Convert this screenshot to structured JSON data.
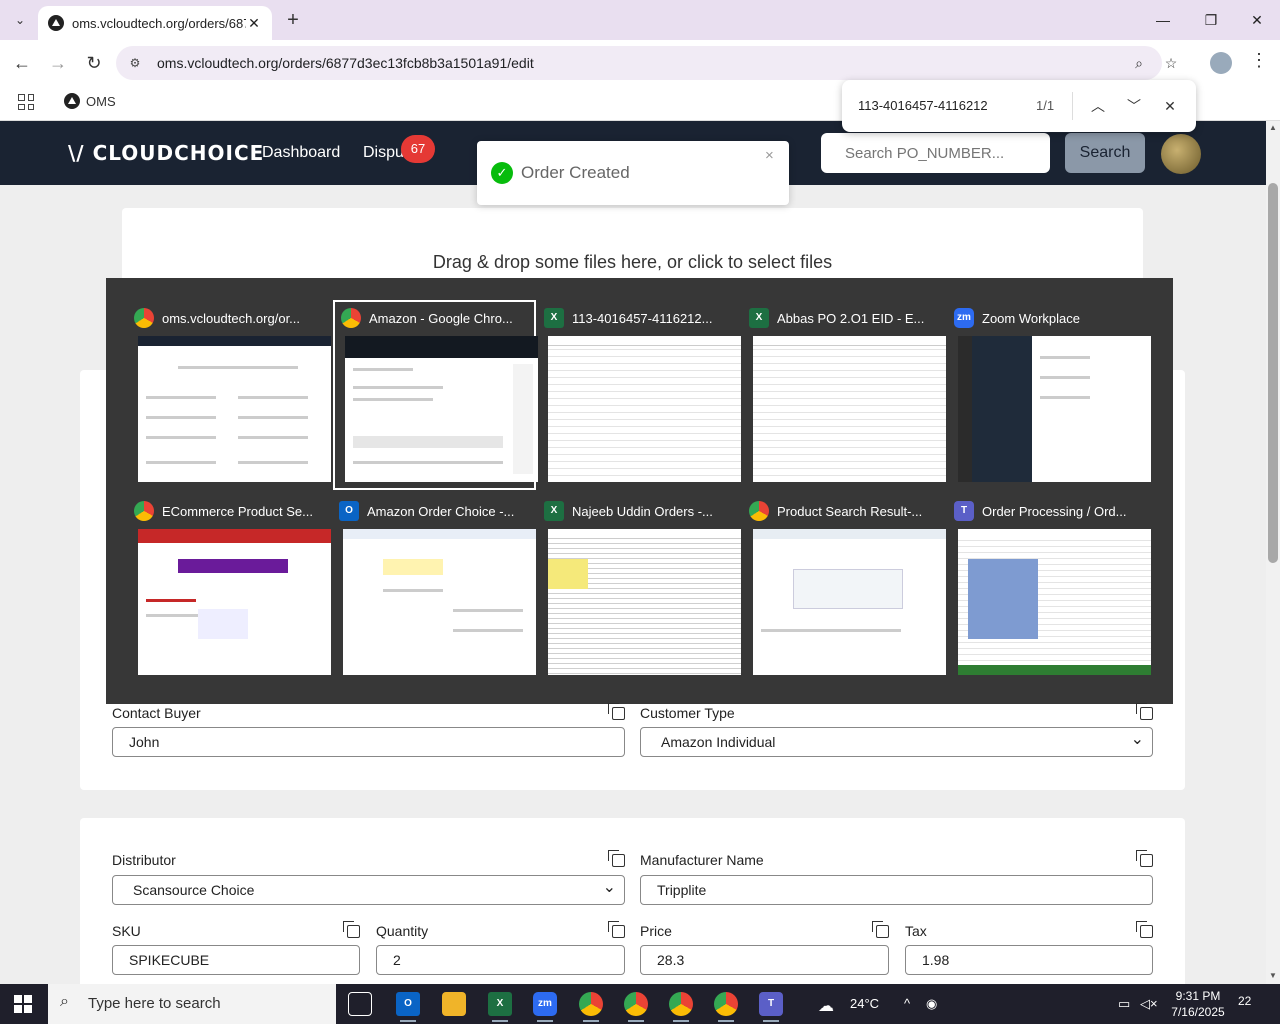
{
  "browser": {
    "tab_title": "oms.vcloudtech.org/orders/687",
    "url": "oms.vcloudtech.org/orders/6877d3ec13fcb8b3a1501a91/edit",
    "bookmark": "OMS"
  },
  "find": {
    "query": "113-4016457-4116212",
    "count": "1/1"
  },
  "app": {
    "logo": "\\/ CLOUDCHOICE",
    "nav_dashboard": "Dashboard",
    "nav_disputes": "Dispu",
    "disputes_badge": "67",
    "search_placeholder": "Search PO_NUMBER...",
    "search_button": "Search"
  },
  "toast": {
    "message": "Order Created",
    "close": "×"
  },
  "dropzone": {
    "text": "Drag & drop some files here, or click to select files"
  },
  "switcher": {
    "windows": [
      {
        "title": "oms.vcloudtech.org/or...",
        "icon": "chrome-icon"
      },
      {
        "title": "Amazon - Google Chro...",
        "icon": "chrome-icon"
      },
      {
        "title": "113-4016457-4116212...",
        "icon": "excel-icon"
      },
      {
        "title": "Abbas PO 2.O1  EID - E...",
        "icon": "excel-icon"
      },
      {
        "title": "Zoom Workplace",
        "icon": "zoom-icon"
      },
      {
        "title": "ECommerce Product Se...",
        "icon": "chrome-icon"
      },
      {
        "title": "Amazon Order Choice -...",
        "icon": "outlook-icon"
      },
      {
        "title": "Najeeb Uddin Orders -...",
        "icon": "excel-icon"
      },
      {
        "title": "Product Search Result-...",
        "icon": "chrome-icon"
      },
      {
        "title": "Order Processing / Ord...",
        "icon": "teams-icon"
      }
    ]
  },
  "form1": {
    "contact_buyer_label": "Contact Buyer",
    "contact_buyer_value": "John",
    "customer_type_label": "Customer Type",
    "customer_type_value": "Amazon Individual"
  },
  "form2": {
    "distributor_label": "Distributor",
    "distributor_value": "Scansource Choice",
    "manufacturer_label": "Manufacturer Name",
    "manufacturer_value": "Tripplite",
    "sku_label": "SKU",
    "sku_value": "SPIKECUBE",
    "quantity_label": "Quantity",
    "quantity_value": "2",
    "price_label": "Price",
    "price_value": "28.3",
    "tax_label": "Tax",
    "tax_value": "1.98"
  },
  "taskbar": {
    "search_placeholder": "Type here to search",
    "weather": "24°C",
    "time": "9:31 PM",
    "date": "7/16/2025",
    "notifications": "22"
  }
}
